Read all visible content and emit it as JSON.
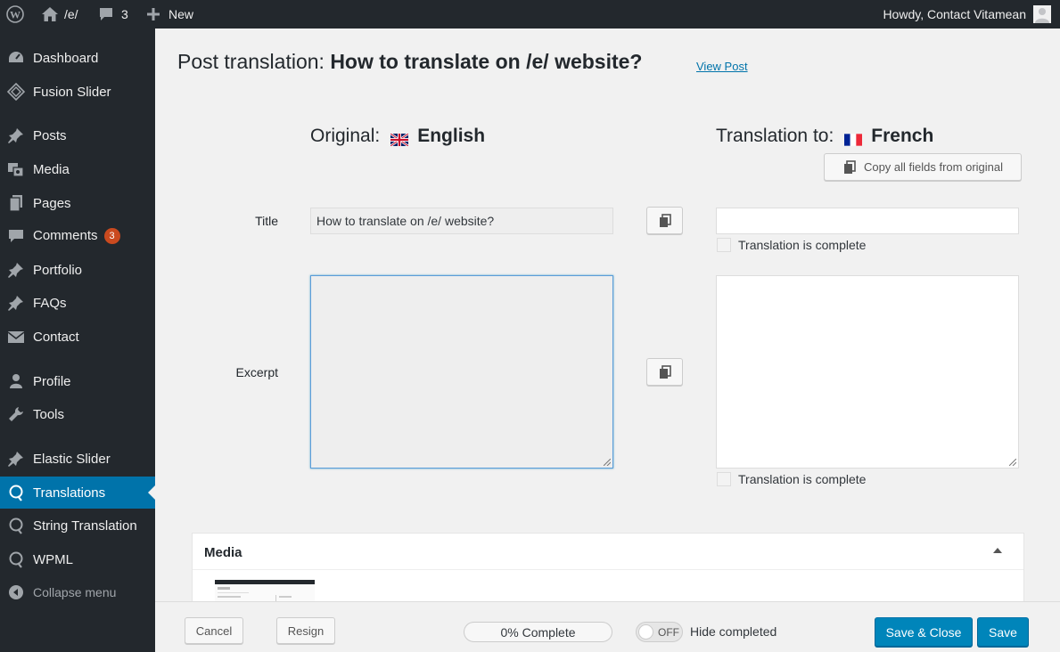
{
  "adminbar": {
    "site_name": "/e/",
    "comments_count": "3",
    "new_label": "New",
    "howdy": "Howdy, Contact Vitamean"
  },
  "sidebar": {
    "items": [
      {
        "label": "Dashboard",
        "icon": "dashboard-icon"
      },
      {
        "label": "Fusion Slider",
        "icon": "fusion-slider-icon"
      },
      {
        "label": "Posts",
        "icon": "pin-icon"
      },
      {
        "label": "Media",
        "icon": "media-icon"
      },
      {
        "label": "Pages",
        "icon": "pages-icon"
      },
      {
        "label": "Comments",
        "icon": "comments-icon",
        "badge": "3"
      },
      {
        "label": "Portfolio",
        "icon": "pin-icon"
      },
      {
        "label": "FAQs",
        "icon": "pin-icon"
      },
      {
        "label": "Contact",
        "icon": "envelope-icon"
      },
      {
        "label": "Profile",
        "icon": "user-icon"
      },
      {
        "label": "Tools",
        "icon": "wrench-icon"
      },
      {
        "label": "Elastic Slider",
        "icon": "pin-icon"
      },
      {
        "label": "Translations",
        "icon": "wpml-icon",
        "active": true
      },
      {
        "label": "String Translation",
        "icon": "wpml-icon"
      },
      {
        "label": "WPML",
        "icon": "wpml-icon"
      },
      {
        "label": "Collapse menu",
        "icon": "collapse-icon"
      }
    ]
  },
  "header": {
    "prefix": "Post translation: ",
    "post_title": "How to translate on /e/ website?",
    "view_post": "View Post"
  },
  "languages": {
    "original_label": "Original:",
    "original_name": "English",
    "translation_label": "Translation to:",
    "translation_name": "French"
  },
  "copy_all_label": "Copy all fields from original",
  "fields": {
    "title": {
      "label": "Title",
      "original_value": "How to translate on /e/ website?",
      "translation_value": "",
      "complete_label": "Translation is complete"
    },
    "excerpt": {
      "label": "Excerpt",
      "original_value": "",
      "translation_value": "",
      "complete_label": "Translation is complete"
    }
  },
  "media_box": {
    "title": "Media"
  },
  "footer": {
    "cancel": "Cancel",
    "resign": "Resign",
    "progress": "0% Complete",
    "toggle_state": "OFF",
    "hide_completed": "Hide completed",
    "save_close": "Save & Close",
    "save": "Save"
  },
  "colors": {
    "admin_dark": "#23282d",
    "accent_blue": "#0073aa",
    "primary_button": "#0085ba",
    "badge": "#ca4a1f"
  }
}
